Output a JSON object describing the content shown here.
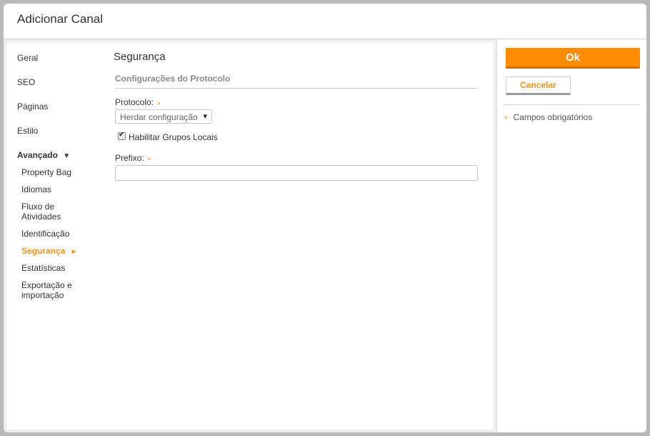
{
  "modal": {
    "title": "Adicionar Canal"
  },
  "nav": {
    "items": [
      {
        "label": "Geral"
      },
      {
        "label": "SEO"
      },
      {
        "label": "Páginas"
      },
      {
        "label": "Estilo"
      }
    ],
    "group": {
      "label": "Avançado",
      "arrow": "▼"
    },
    "sub_items": [
      {
        "label": "Property Bag"
      },
      {
        "label": "Idiomas"
      },
      {
        "label": "Fluxo de Atividades"
      },
      {
        "label": "Identificação"
      },
      {
        "label": "Segurança",
        "active": true,
        "arrow": "►"
      },
      {
        "label": "Estatísticas"
      },
      {
        "label": "Exportação e importação"
      }
    ]
  },
  "form": {
    "section_title": "Segurança",
    "fieldset_legend": "Configurações do Protocolo",
    "protocol_label": "Protocolo:",
    "protocol_value": "Herdar configuração",
    "enable_local_groups_label": "Habilitar Grupos Locais",
    "enable_local_groups_checked": true,
    "prefix_label": "Prefixo:",
    "prefix_value": "",
    "required_marker": "⁎"
  },
  "actions": {
    "ok_label": "Ok",
    "cancel_label": "Cancelar",
    "required_note": "Campos obrigatórios"
  },
  "colors": {
    "accent": "#ff8c00",
    "accent_text": "#f7941d",
    "background": "#b9b9b9"
  }
}
